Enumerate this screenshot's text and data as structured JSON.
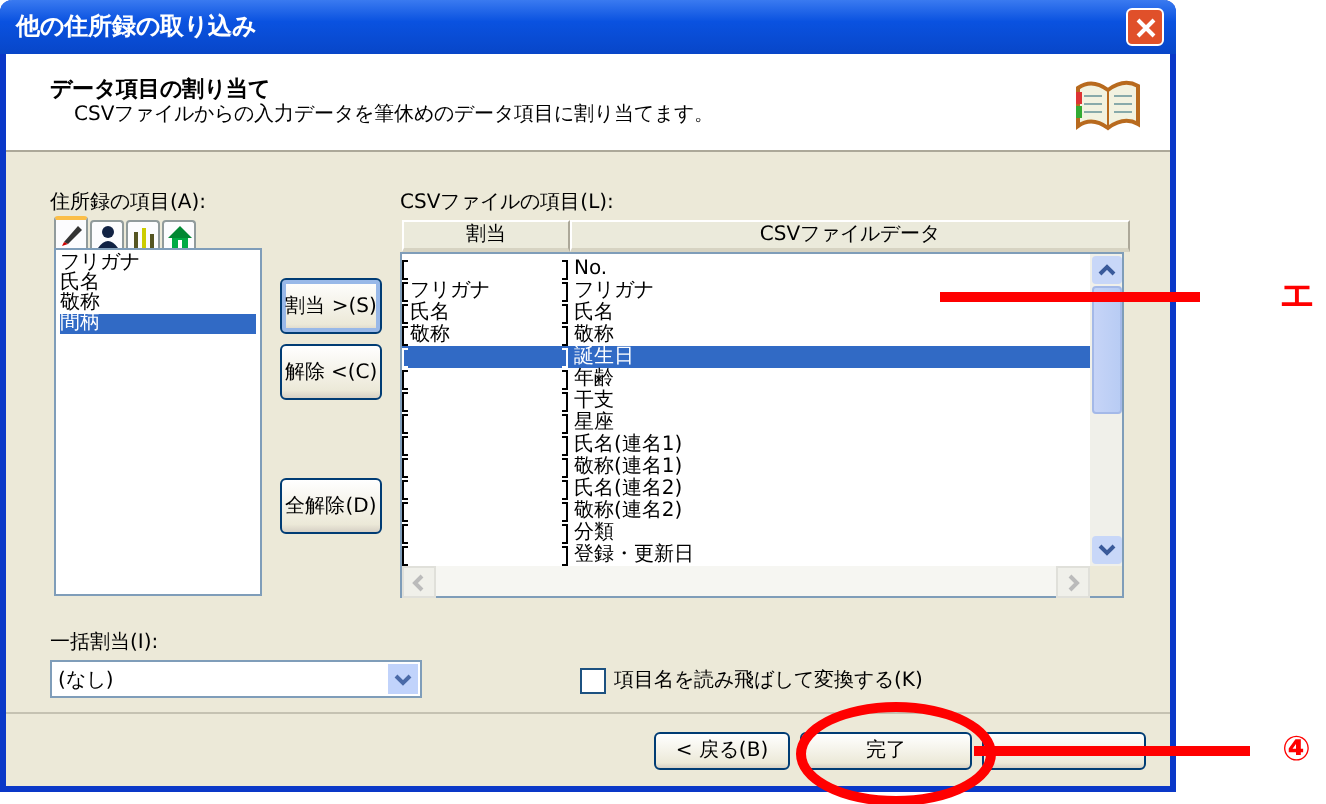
{
  "window": {
    "title": "他の住所録の取り込み"
  },
  "header": {
    "title": "データ項目の割り当て",
    "description": "CSVファイルからの入力データを筆休めのデータ項目に割り当てます。"
  },
  "address_fields": {
    "label": "住所録の項目(A):",
    "tabs": [
      {
        "kind": "pen",
        "selected": true
      },
      {
        "kind": "person",
        "selected": false
      },
      {
        "kind": "chart",
        "selected": false
      },
      {
        "kind": "house",
        "selected": false
      }
    ],
    "items": [
      {
        "text": "フリガナ",
        "selected": false
      },
      {
        "text": "氏名",
        "selected": false
      },
      {
        "text": "敬称",
        "selected": false
      },
      {
        "text": "間柄",
        "selected": true
      }
    ]
  },
  "assign_buttons": [
    {
      "label": "割当 >(S)",
      "focused": true
    },
    {
      "label": "解除 <(C)",
      "focused": false
    },
    {
      "label": "全解除(D)",
      "focused": false
    }
  ],
  "csv_fields": {
    "label": "CSVファイルの項目(L):",
    "columns": [
      "割当",
      "CSVファイルデータ"
    ],
    "rows": [
      {
        "assigned": "",
        "data": "No.",
        "selected": false
      },
      {
        "assigned": "フリガナ",
        "data": "フリガナ",
        "selected": false
      },
      {
        "assigned": "氏名",
        "data": "氏名",
        "selected": false
      },
      {
        "assigned": "敬称",
        "data": "敬称",
        "selected": false
      },
      {
        "assigned": "",
        "data": "誕生日",
        "selected": true
      },
      {
        "assigned": "",
        "data": "年齢",
        "selected": false
      },
      {
        "assigned": "",
        "data": "干支",
        "selected": false
      },
      {
        "assigned": "",
        "data": "星座",
        "selected": false
      },
      {
        "assigned": "",
        "data": "氏名(連名1)",
        "selected": false
      },
      {
        "assigned": "",
        "data": "敬称(連名1)",
        "selected": false
      },
      {
        "assigned": "",
        "data": "氏名(連名2)",
        "selected": false
      },
      {
        "assigned": "",
        "data": "敬称(連名2)",
        "selected": false
      },
      {
        "assigned": "",
        "data": "分類",
        "selected": false
      },
      {
        "assigned": "",
        "data": "登録・更新日",
        "selected": false
      }
    ]
  },
  "bulk_assign": {
    "label": "一括割当(I):",
    "value": "(なし)"
  },
  "skip_header": {
    "label": "項目名を読み飛ばして変換する(K)",
    "checked": false
  },
  "footer_buttons": [
    {
      "label": "< 戻る(B)",
      "kind": "back"
    },
    {
      "label": "完了",
      "kind": "finish"
    },
    {
      "kind": "cancel"
    }
  ],
  "annotations": [
    {
      "kind": "line",
      "text": "エ"
    },
    {
      "kind": "ring",
      "text": "④"
    }
  ]
}
